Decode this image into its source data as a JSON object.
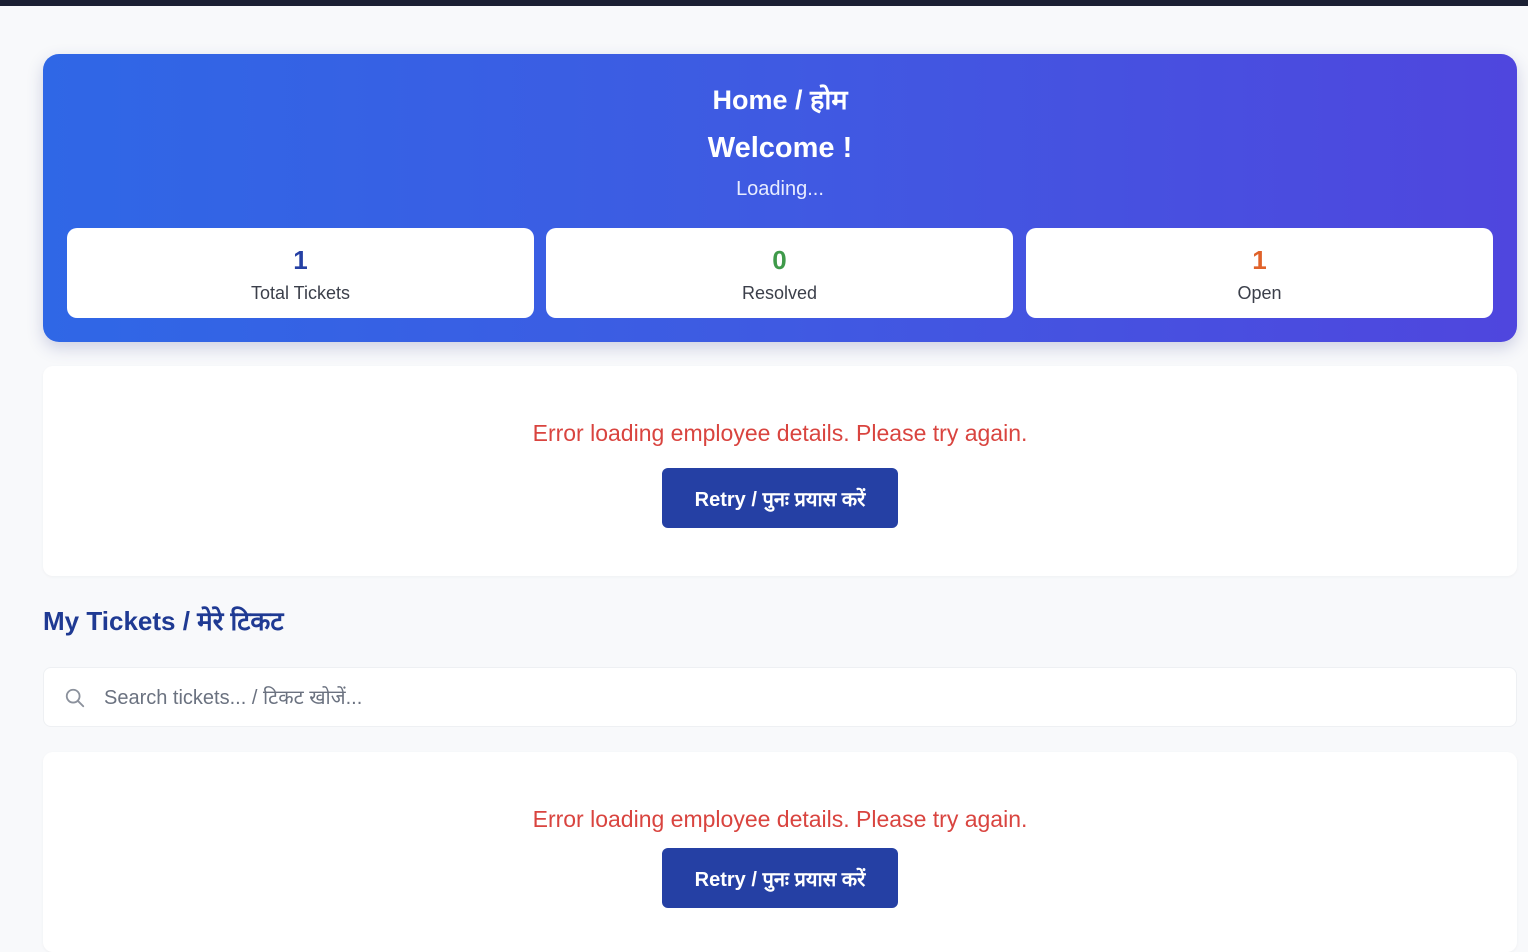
{
  "hero": {
    "breadcrumb": "Home / होम",
    "title": "Welcome !",
    "status": "Loading...",
    "accent_gradient": [
      "#2f67e6",
      "#4f46de"
    ]
  },
  "stats": [
    {
      "value": "1",
      "label": "Total Tickets",
      "color": "#2540a4"
    },
    {
      "value": "0",
      "label": "Resolved",
      "color": "#3f9a4a"
    },
    {
      "value": "1",
      "label": "Open",
      "color": "#e0622a"
    }
  ],
  "employee_panel": {
    "error": "Error loading employee details. Please try again.",
    "retry_label": "Retry / पुनः प्रयास करें"
  },
  "tickets": {
    "title": "My Tickets / मेरे टिकट",
    "search_placeholder": "Search tickets... / टिकट खोजें...",
    "search_icon": "search-icon",
    "error": "Error loading employee details. Please try again.",
    "retry_label": "Retry / पुनः प्रयास करें"
  },
  "colors": {
    "error": "#d9443f",
    "button": "#2540a4",
    "section_title": "#1f3a93"
  }
}
